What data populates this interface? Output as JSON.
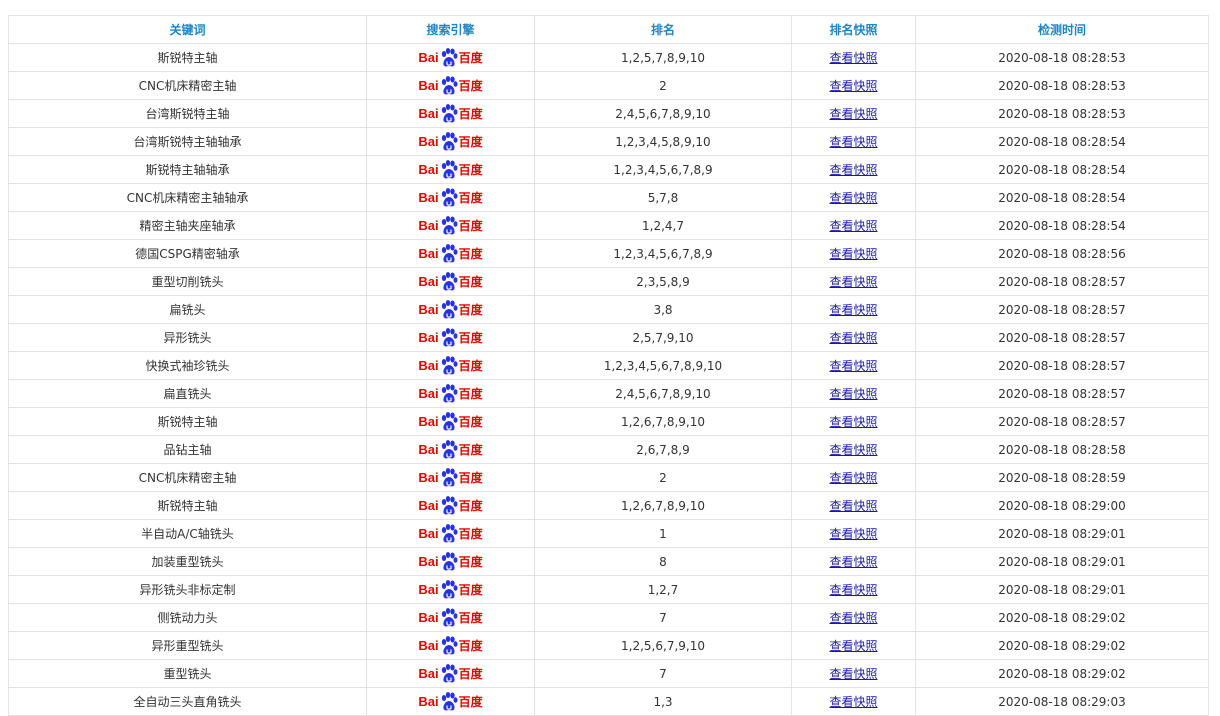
{
  "table": {
    "headers": {
      "keyword": "关键词",
      "engine": "搜索引擎",
      "rank": "排名",
      "snapshot": "排名快照",
      "time": "检测时间"
    },
    "engine_logo": {
      "text_left": "Bai",
      "text_right": "百度",
      "icon": "baidu-paw-icon",
      "color_red": "#e10602",
      "color_blue": "#2932e1"
    },
    "rows": [
      {
        "keyword": "斯锐特主轴",
        "rank": "1,2,5,7,8,9,10",
        "snapshot": "查看快照",
        "time": "2020-08-18 08:28:53"
      },
      {
        "keyword": "CNC机床精密主轴",
        "rank": "2",
        "snapshot": "查看快照",
        "time": "2020-08-18 08:28:53"
      },
      {
        "keyword": "台湾斯锐特主轴",
        "rank": "2,4,5,6,7,8,9,10",
        "snapshot": "查看快照",
        "time": "2020-08-18 08:28:53"
      },
      {
        "keyword": "台湾斯锐特主轴轴承",
        "rank": "1,2,3,4,5,8,9,10",
        "snapshot": "查看快照",
        "time": "2020-08-18 08:28:54"
      },
      {
        "keyword": "斯锐特主轴轴承",
        "rank": "1,2,3,4,5,6,7,8,9",
        "snapshot": "查看快照",
        "time": "2020-08-18 08:28:54"
      },
      {
        "keyword": "CNC机床精密主轴轴承",
        "rank": "5,7,8",
        "snapshot": "查看快照",
        "time": "2020-08-18 08:28:54"
      },
      {
        "keyword": "精密主轴夹座轴承",
        "rank": "1,2,4,7",
        "snapshot": "查看快照",
        "time": "2020-08-18 08:28:54"
      },
      {
        "keyword": "德国CSPG精密轴承",
        "rank": "1,2,3,4,5,6,7,8,9",
        "snapshot": "查看快照",
        "time": "2020-08-18 08:28:56"
      },
      {
        "keyword": "重型切削铣头",
        "rank": "2,3,5,8,9",
        "snapshot": "查看快照",
        "time": "2020-08-18 08:28:57"
      },
      {
        "keyword": "扁铣头",
        "rank": "3,8",
        "snapshot": "查看快照",
        "time": "2020-08-18 08:28:57"
      },
      {
        "keyword": "异形铣头",
        "rank": "2,5,7,9,10",
        "snapshot": "查看快照",
        "time": "2020-08-18 08:28:57"
      },
      {
        "keyword": "快换式袖珍铣头",
        "rank": "1,2,3,4,5,6,7,8,9,10",
        "snapshot": "查看快照",
        "time": "2020-08-18 08:28:57"
      },
      {
        "keyword": "扁直铣头",
        "rank": "2,4,5,6,7,8,9,10",
        "snapshot": "查看快照",
        "time": "2020-08-18 08:28:57"
      },
      {
        "keyword": "斯锐特主轴",
        "rank": "1,2,6,7,8,9,10",
        "snapshot": "查看快照",
        "time": "2020-08-18 08:28:57"
      },
      {
        "keyword": "品钻主轴",
        "rank": "2,6,7,8,9",
        "snapshot": "查看快照",
        "time": "2020-08-18 08:28:58"
      },
      {
        "keyword": "CNC机床精密主轴",
        "rank": "2",
        "snapshot": "查看快照",
        "time": "2020-08-18 08:28:59"
      },
      {
        "keyword": "斯锐特主轴",
        "rank": "1,2,6,7,8,9,10",
        "snapshot": "查看快照",
        "time": "2020-08-18 08:29:00"
      },
      {
        "keyword": "半自动A/C轴铣头",
        "rank": "1",
        "snapshot": "查看快照",
        "time": "2020-08-18 08:29:01"
      },
      {
        "keyword": "加装重型铣头",
        "rank": "8",
        "snapshot": "查看快照",
        "time": "2020-08-18 08:29:01"
      },
      {
        "keyword": "异形铣头非标定制",
        "rank": "1,2,7",
        "snapshot": "查看快照",
        "time": "2020-08-18 08:29:01"
      },
      {
        "keyword": "侧铣动力头",
        "rank": "7",
        "snapshot": "查看快照",
        "time": "2020-08-18 08:29:02"
      },
      {
        "keyword": "异形重型铣头",
        "rank": "1,2,5,6,7,9,10",
        "snapshot": "查看快照",
        "time": "2020-08-18 08:29:02"
      },
      {
        "keyword": "重型铣头",
        "rank": "7",
        "snapshot": "查看快照",
        "time": "2020-08-18 08:29:02"
      },
      {
        "keyword": "全自动三头直角铣头",
        "rank": "1,3",
        "snapshot": "查看快照",
        "time": "2020-08-18 08:29:03"
      }
    ]
  }
}
